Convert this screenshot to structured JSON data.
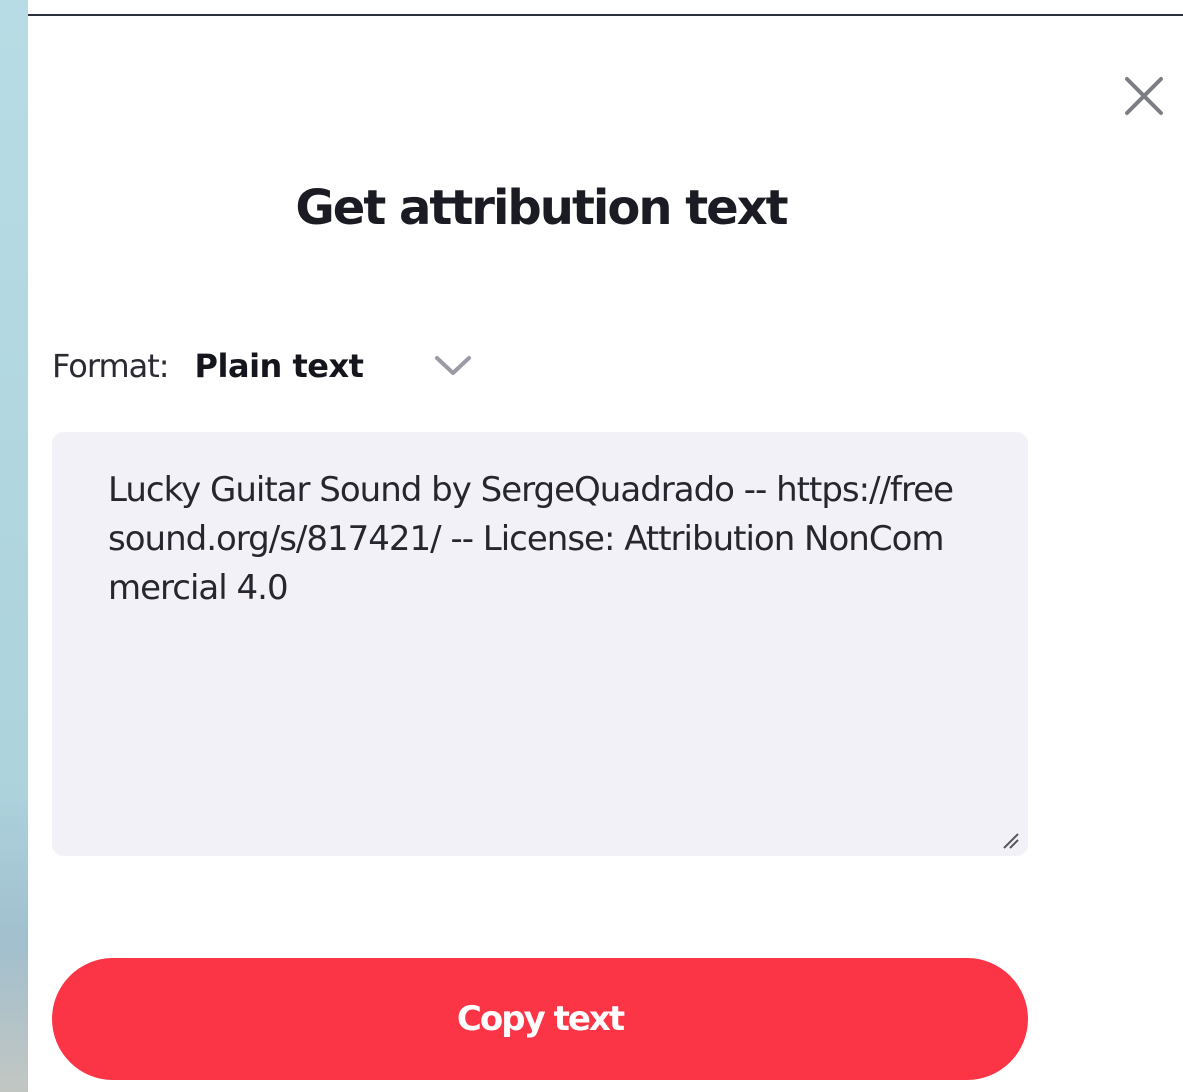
{
  "modal": {
    "title": "Get attribution text",
    "close_icon": "close-icon"
  },
  "format": {
    "label": "Format:",
    "selected": "Plain text",
    "chevron_icon": "chevron-down-icon"
  },
  "attribution": {
    "text": "Lucky Guitar Sound by SergeQuadrado -- https://freesound.org/s/817421/ -- License: Attribution NonCommercial 4.0"
  },
  "actions": {
    "copy_label": "Copy text"
  },
  "colors": {
    "accent": "#fb3446",
    "textarea_bg": "#f2f1f7",
    "backdrop": "#b7dbe3"
  }
}
